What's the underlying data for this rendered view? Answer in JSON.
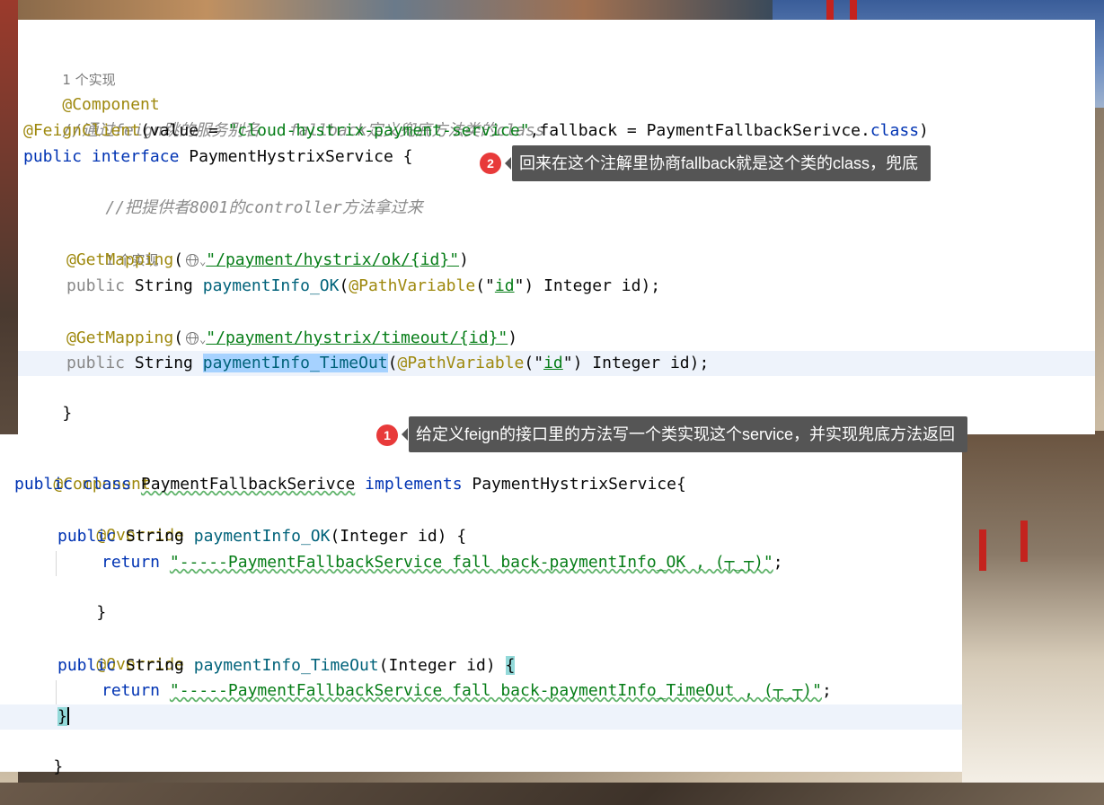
{
  "top_code": {
    "impl_hint_1": "1 个实现",
    "component": "@Component",
    "comment_1": "//通过feign跳的服务别名   fallback定义兜底方法类的class",
    "feign_annotation": "@FeignClient",
    "feign_open": "(value = ",
    "feign_value": "\"cloud-hystrix-payment-service\"",
    "feign_mid": ",fallback = PaymentFallbackSerivce.",
    "feign_class_kw": "class",
    "feign_close": ")",
    "public_kw": "public",
    "interface_kw": "interface",
    "interface_name": " PaymentHystrixService {",
    "comment_2": "//把提供者8001的controller方法拿过来",
    "impl_hint_2": "1 个实现",
    "getmapping": "@GetMapping",
    "paren_open": "(",
    "chevron": "⌄",
    "path_ok": "\"/payment/hystrix/ok/{id}\"",
    "paren_close": ")",
    "method_public": "public",
    "string_type": " String ",
    "method_ok": "paymentInfo_OK",
    "pathvariable": "@PathVariable",
    "id_str_q1": "(\"",
    "id_str": "id",
    "id_str_q2": "\")",
    "param_tail": " Integer id);",
    "path_timeout": "\"/payment/hystrix/timeout/{id}\"",
    "method_timeout": "paymentInfo_TimeOut",
    "closing_brace": "}"
  },
  "bottom_code": {
    "component": "@Component",
    "public_kw": "public",
    "class_kw": "class",
    "class_name": "PaymentFallbackSerivce",
    "implements_kw": "implements",
    "iface": " PaymentHystrixService{",
    "override": "@Override",
    "string_type": " String ",
    "method_ok": "paymentInfo_OK",
    "params_ok": "(Integer id) {",
    "return_kw": "return",
    "ret_ok": "\"-----PaymentFallbackService fall back-paymentInfo_OK , (┬_┬)\"",
    "semicolon": ";",
    "close_brace": "}",
    "method_timeout": "paymentInfo_TimeOut",
    "params_timeout": "(Integer id) ",
    "open_brace": "{",
    "ret_timeout": "\"-----PaymentFallbackService fall back-paymentInfo_TimeOut , (┬_┬)\"",
    "class_close": "}"
  },
  "tooltips": {
    "tip1_num": "1",
    "tip1_text": "给定义feign的接口里的方法写一个类实现这个service，并实现兜底方法返回",
    "tip2_num": "2",
    "tip2_text": "回来在这个注解里协商fallback就是这个类的class，兜底"
  }
}
